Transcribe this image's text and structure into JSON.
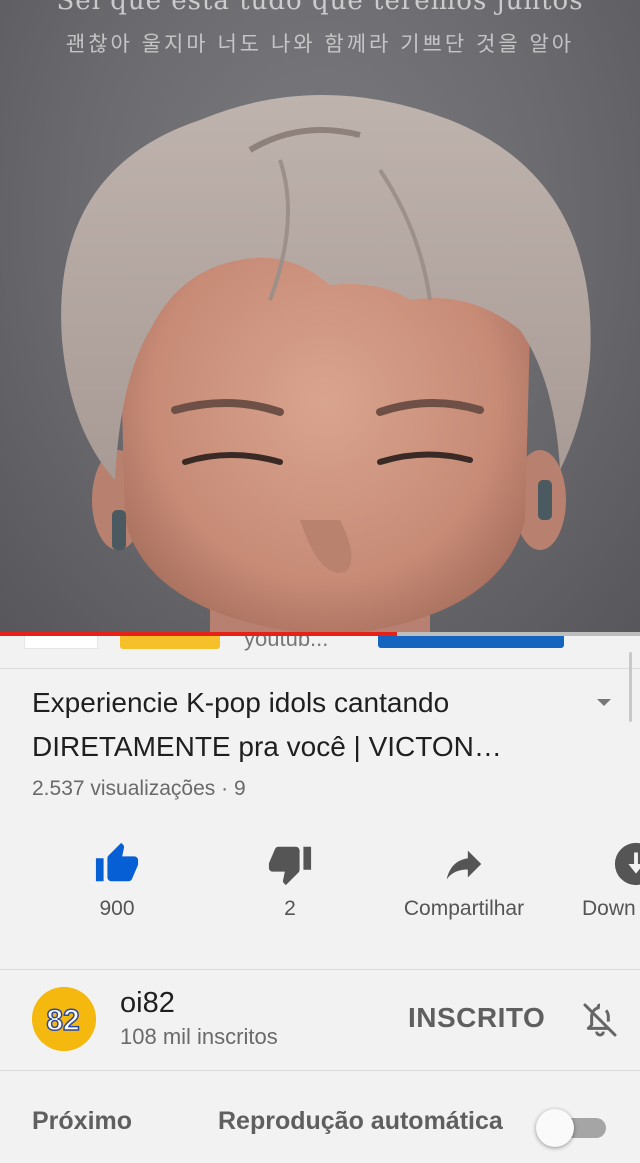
{
  "player": {
    "subtitle_top": "Sei que está tudo que teremos juntos",
    "subtitle_ko": "괜찮아 울지마 너도 나와 함께라 기쁘단 것을 알아",
    "progress_fraction": 0.62,
    "colors": {
      "progress": "#e62117",
      "buffer": "#bdbdbd"
    }
  },
  "peek": {
    "text": "youtub..."
  },
  "video": {
    "title": "Experiencie K-pop idols cantando DIRETAMENTE pra você | VICTON…",
    "meta": "2.537 visualizações · 9"
  },
  "actions": {
    "like": {
      "label": "900",
      "icon": "thumbs-up-icon",
      "color": "#065fd4"
    },
    "dislike": {
      "label": "2",
      "icon": "thumbs-down-icon"
    },
    "share": {
      "label": "Compartilhar",
      "icon": "share-icon"
    },
    "download": {
      "label": "Down",
      "icon": "download-icon"
    }
  },
  "channel": {
    "name": "oi82",
    "subscribers": "108 mil inscritos",
    "avatar_text": "82",
    "subscribe_label": "INSCRITO",
    "bell_icon": "notifications-off-icon"
  },
  "upnext": {
    "label": "Próximo",
    "autoplay_label": "Reprodução automática",
    "autoplay_on": false
  }
}
